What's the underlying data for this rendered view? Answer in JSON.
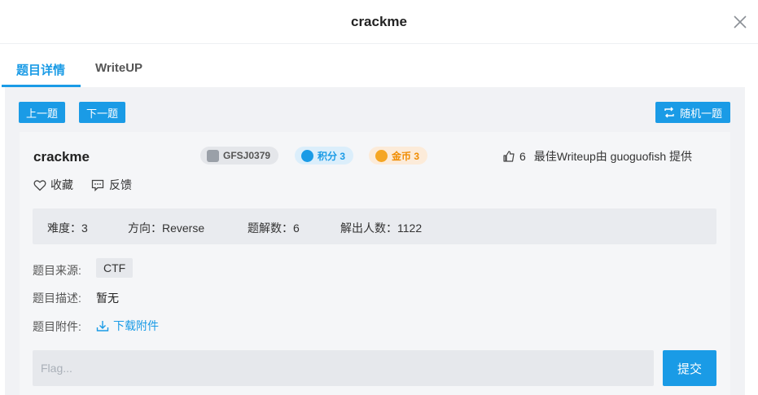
{
  "dialog": {
    "title": "crackme"
  },
  "tabs": [
    {
      "label": "题目详情"
    },
    {
      "label": "WriteUP"
    }
  ],
  "nav": {
    "prev_label": "上一题",
    "next_label": "下一题",
    "random_label": "随机一题"
  },
  "challenge": {
    "name": "crackme",
    "id": "GFSJ0379",
    "score_label": "积分 3",
    "coin_label": "金币 3",
    "likes": "6",
    "best_writeup": "最佳Writeup由 guoguofish 提供",
    "favorite_label": "收藏",
    "feedback_label": "反馈",
    "stats": {
      "difficulty": "难度：3",
      "direction": "方向：Reverse",
      "solved_wp": "题解数：6",
      "solvers": "解出人数：1122"
    },
    "source_label": "题目来源:",
    "source_value": "CTF",
    "desc_label": "题目描述:",
    "desc_value": "暂无",
    "attachment_label": "题目附件:",
    "download_label": "下载附件"
  },
  "flag": {
    "placeholder": "Flag...",
    "submit_label": "提交"
  },
  "colors": {
    "accent": "#1a9be6",
    "score_tag_bg": "#dbeefb",
    "coin_tag_bg": "#fcebd9",
    "coin_text": "#f08c00"
  },
  "icons": [
    "close-icon",
    "refresh-icon",
    "id-avatar-icon",
    "score-star-icon",
    "coin-icon",
    "thumbs-up-icon",
    "heart-icon",
    "feedback-icon",
    "download-icon"
  ]
}
